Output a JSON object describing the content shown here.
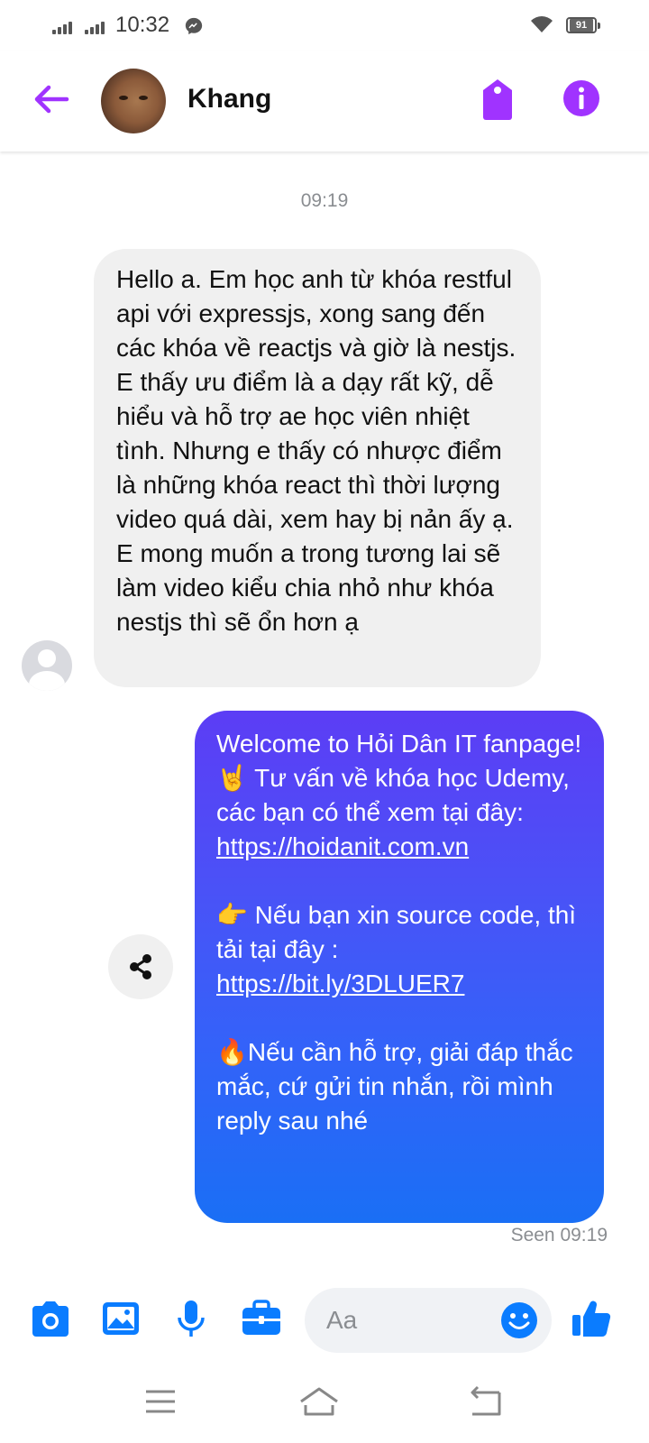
{
  "status_bar": {
    "time": "10:32",
    "battery": "91"
  },
  "header": {
    "contact_name": "Khang",
    "icons": [
      "back-arrow-icon",
      "contact-avatar",
      "tag-icon",
      "info-icon"
    ]
  },
  "chat": {
    "timestamp": "09:19",
    "incoming": {
      "text": "Hello a. Em học anh từ khóa restful api với expressjs, xong sang đến các khóa về reactjs và giờ là nestjs. E thấy ưu điểm là a dạy rất kỹ, dễ hiểu và hỗ trợ ae học viên nhiệt tình. Nhưng e thấy có nhược điểm là những khóa react thì thời lượng video quá dài, xem hay bị nản ấy ạ. E mong muốn a trong tương lai sẽ làm video kiểu chia nhỏ như khóa nestjs thì sẽ ổn hơn ạ"
    },
    "outgoing": {
      "line1": "Welcome to Hỏi Dân IT fanpage!",
      "line2": "🤘  Tư vấn về khóa học Udemy, các bạn có thể xem tại đây:",
      "link1": "https://hoidanit.com.vn",
      "line3": "👉 Nếu bạn xin source code, thì tải tại đây :",
      "link2": "https://bit.ly/3DLUER7",
      "line4": "🔥Nếu cần hỗ trợ, giải đáp thắc mắc, cứ gửi tin nhắn, rồi mình reply sau nhé"
    },
    "seen": "Seen 09:19"
  },
  "composer": {
    "placeholder": "Aa",
    "icons": [
      "camera-icon",
      "gallery-icon",
      "microphone-icon",
      "briefcase-icon",
      "emoji-icon",
      "like-icon"
    ]
  },
  "navbar": {
    "icons": [
      "menu-icon",
      "home-icon",
      "back-icon"
    ]
  },
  "colors": {
    "accent": "#a033ff",
    "composer_blue": "#0a7cff",
    "bubble_gray": "#f0f0f0"
  }
}
